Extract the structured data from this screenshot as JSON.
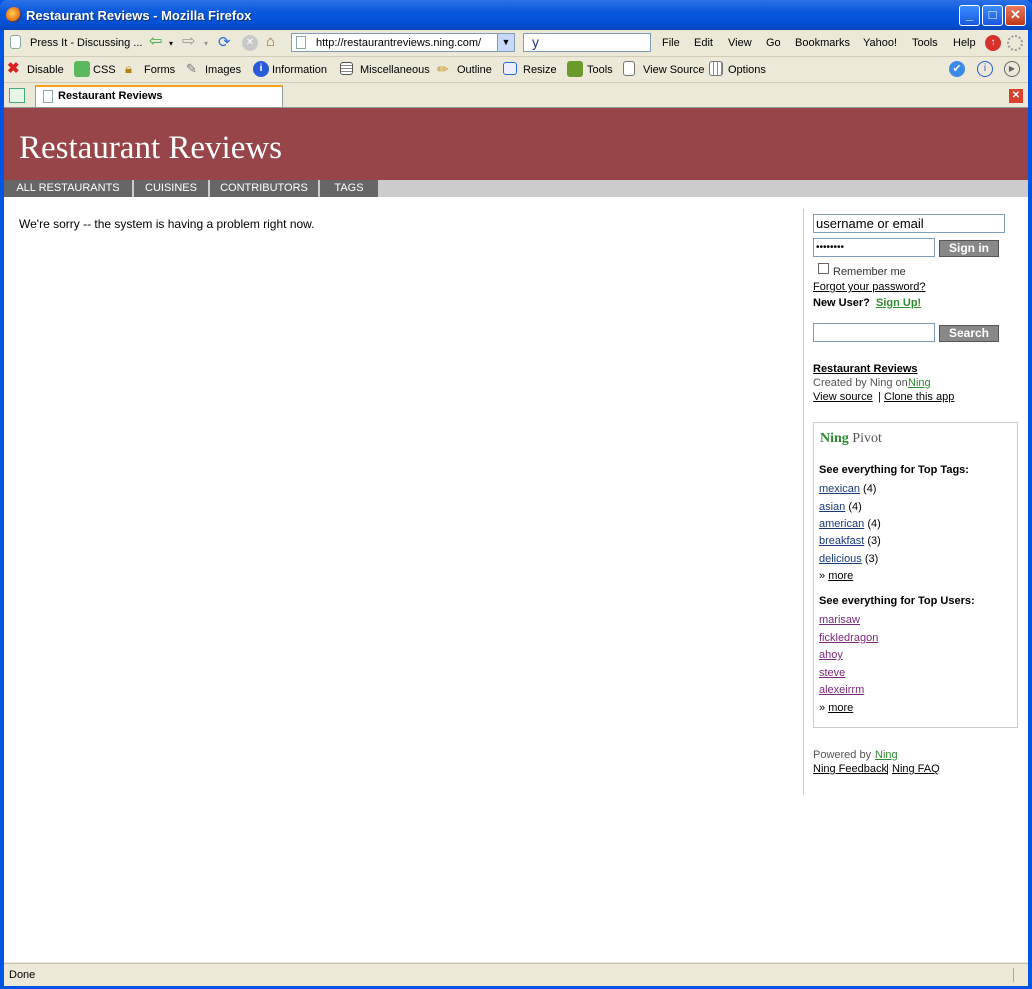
{
  "window": {
    "title": "Restaurant Reviews - Mozilla Firefox",
    "buttons": {
      "minimize": "_",
      "maximize": "□",
      "close": "✕"
    }
  },
  "navbar": {
    "press_it": "Press It - Discussing ...",
    "url": "http://restaurantreviews.ning.com/",
    "search_engine_glyph": "y",
    "menu": [
      "File",
      "Edit",
      "View",
      "Go",
      "Bookmarks",
      "Yahoo!",
      "Tools",
      "Help"
    ]
  },
  "devbar": {
    "items": [
      "Disable",
      "CSS",
      "Forms",
      "Images",
      "Information",
      "Miscellaneous",
      "Outline",
      "Resize",
      "Tools",
      "View Source",
      "Options"
    ]
  },
  "tab": {
    "label": "Restaurant Reviews"
  },
  "site": {
    "title": "Restaurant Reviews",
    "nav": [
      "ALL RESTAURANTS",
      "CUISINES",
      "CONTRIBUTORS",
      "TAGS"
    ],
    "error": "We're sorry -- the system is having a problem right now."
  },
  "sidebar": {
    "username_placeholder": "username or email",
    "password_value": "••••••••",
    "sign_in": "Sign in",
    "remember_me": "Remember me",
    "forgot": "Forgot your password?",
    "new_user": "New User?",
    "sign_up": "Sign Up!",
    "search_button": "Search",
    "app_name": "Restaurant Reviews",
    "created_by": "Created by Ning on",
    "created_on": "Ning",
    "view_source": "View source",
    "separator": "|",
    "clone": "Clone this app",
    "pivot_title_a": "Ning",
    "pivot_title_b": "Pivot",
    "top_tags_heading": "See everything for Top Tags:",
    "top_tags": [
      {
        "name": "mexican",
        "count": "(4)"
      },
      {
        "name": "asian",
        "count": "(4)"
      },
      {
        "name": "american",
        "count": "(4)"
      },
      {
        "name": "breakfast",
        "count": "(3)"
      },
      {
        "name": "delicious",
        "count": "(3)"
      }
    ],
    "more_prefix": "»",
    "more": "more",
    "top_users_heading": "See everything for Top Users:",
    "top_users": [
      "marisaw",
      "fickledragon",
      "ahoy",
      "steve",
      "alexeirrm"
    ],
    "powered_by": "Powered by",
    "powered_by_link": "Ning",
    "feedback": "Ning Feedback",
    "faq": "Ning FAQ"
  },
  "status": {
    "text": "Done"
  }
}
